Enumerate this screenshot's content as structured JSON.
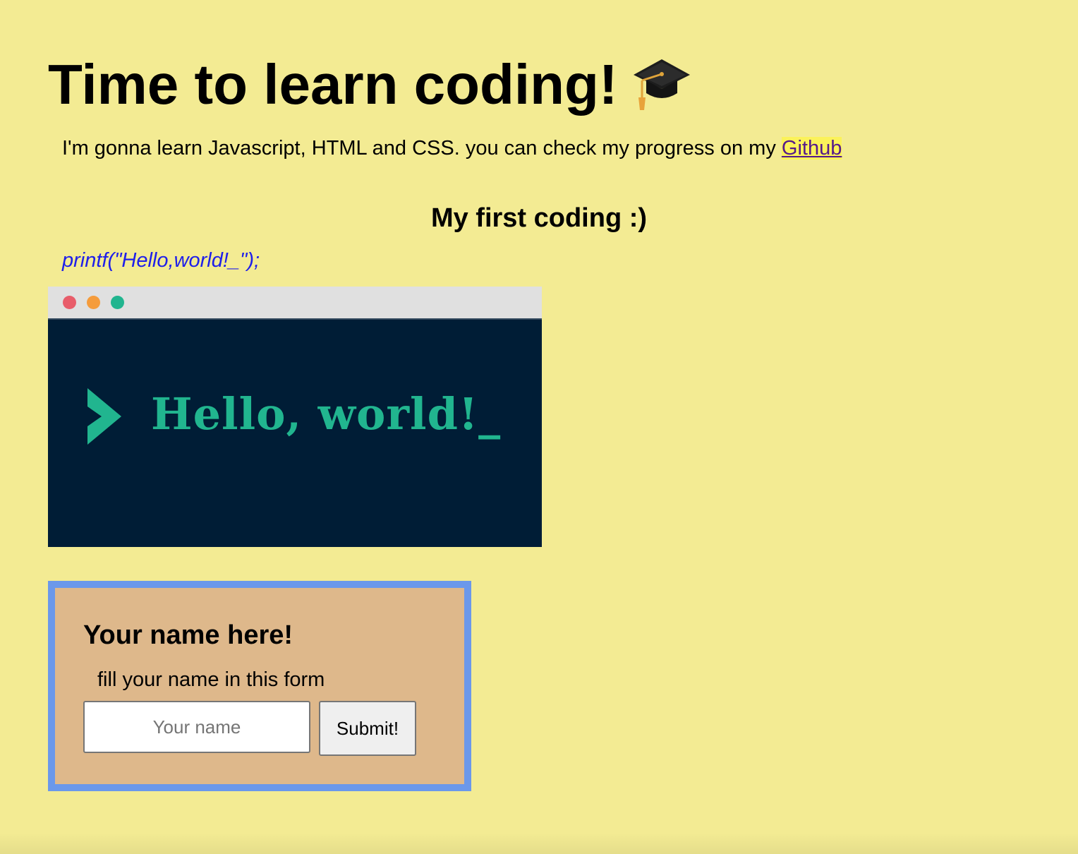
{
  "header": {
    "title": "Time to learn coding!",
    "title_icon": "graduation-cap-icon"
  },
  "intro": {
    "text": "I'm gonna learn Javascript, HTML and CSS. you can check my progress on my ",
    "link_label": "Github"
  },
  "section": {
    "title": "My first coding :)",
    "code": "printf(\"Hello,world!_\");"
  },
  "hero_image": {
    "text": "Hello, world!_",
    "chevron_icon": "chevron-right-icon",
    "colors": {
      "background": "#001d36",
      "accent": "#21b58f",
      "bar": "#e0e0e0",
      "dot_red": "#e85d6a",
      "dot_orange": "#f59c3c",
      "dot_green": "#21b58f"
    }
  },
  "form": {
    "title": "Your name here!",
    "description": "fill your name in this form",
    "input_value": "",
    "input_placeholder": "Your name",
    "submit_label": "Submit!"
  },
  "colors": {
    "page_background": "#f3eb93",
    "form_background": "#deb88b",
    "form_border": "#6b98ea",
    "code_text": "#1e1eea",
    "link": "#551a8b"
  }
}
